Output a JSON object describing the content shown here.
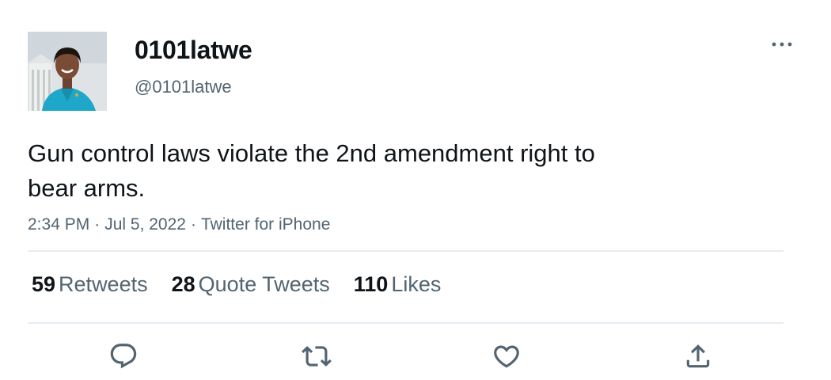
{
  "tweet": {
    "display_name": "0101latwe",
    "handle": "@0101latwe",
    "text_line1": "Gun control laws violate the 2nd amendment right to",
    "text_line2": "bear arms.",
    "time": "2:34 PM",
    "date": "Jul 5, 2022",
    "source": "Twitter for iPhone",
    "separator": "·"
  },
  "stats": {
    "retweets_count": "59",
    "retweets_label": "Retweets",
    "quotes_count": "28",
    "quotes_label": "Quote Tweets",
    "likes_count": "110",
    "likes_label": "Likes"
  },
  "icons": {
    "more": "more-horizontal-icon",
    "reply": "reply-icon",
    "retweet": "retweet-icon",
    "like": "heart-icon",
    "share": "share-icon"
  },
  "colors": {
    "text_primary": "#0f1419",
    "text_secondary": "#536471",
    "divider": "#e6ecf0",
    "avatar_outfit": "#1ea7c8"
  }
}
